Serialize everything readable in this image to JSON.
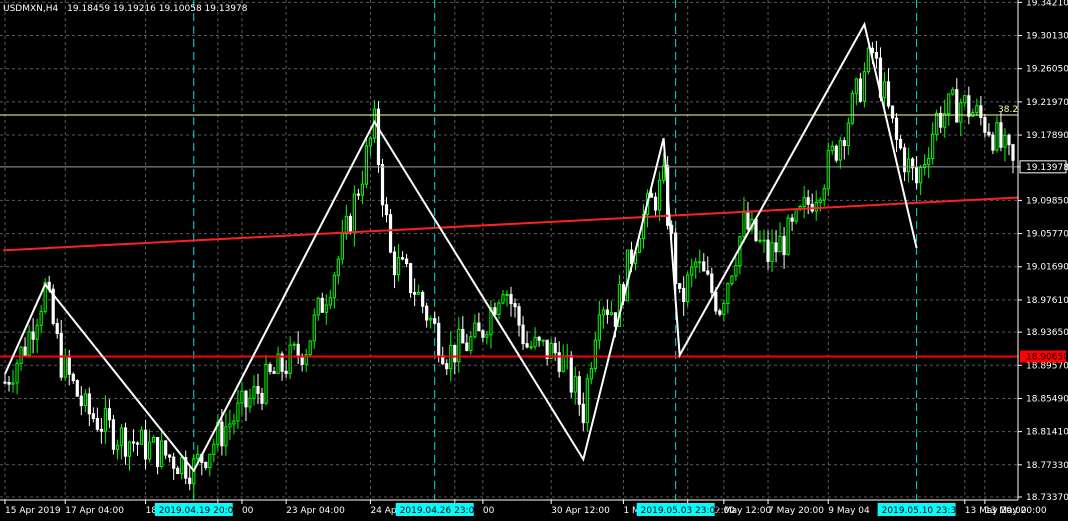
{
  "window": {
    "symbol_timeframe": "USDMXN,H4",
    "ohlc": "19.18459 19.19216 19.10058 19.13978"
  },
  "colors": {
    "background": "#000000",
    "grid": "#5a5a5a",
    "axis": "#ffffff",
    "bull_candle": "#00ff00",
    "bear_candle": "#ffffff",
    "zigzag": "#ffffff",
    "trend_line": "#ff2020",
    "horizontal_line": "#ff0000",
    "fibo_line": "#ffff99",
    "time_marker_line": "#00e0e0",
    "time_marker_box": "#00ffff",
    "price_marker_box": "#ff0000"
  },
  "chart_data": {
    "type": "candlestick",
    "ylim": [
      18.73,
      19.345
    ],
    "y_ticks": [
      "19.34210",
      "19.30130",
      "19.26050",
      "19.21970",
      "19.17890",
      "19.13978",
      "19.09850",
      "19.05770",
      "19.01690",
      "18.97610",
      "18.93650",
      "18.89570",
      "18.85490",
      "18.81410",
      "18.77330",
      "18.73370"
    ],
    "y_tick_values": [
      19.3421,
      19.3013,
      19.2605,
      19.2197,
      19.1789,
      19.13978,
      19.0985,
      19.0577,
      19.0169,
      18.9761,
      18.9365,
      18.8957,
      18.8549,
      18.8141,
      18.7733,
      18.7337
    ],
    "x_ticks": [
      "15 Apr 2019",
      "17 Apr 04:00",
      "18 Ap",
      "00",
      "23 Apr 04:00",
      "24 Apr 12:00",
      "25",
      "30 Apr 12:00",
      "1 May 20:00",
      "May 12:00",
      "7 May 20:00",
      "9 May 04",
      "13 May 20:00"
    ],
    "x_tick_index": [
      0,
      15,
      35,
      53,
      70,
      91,
      112,
      136,
      154,
      170,
      190,
      205,
      244
    ],
    "n_bars": 252,
    "current_price": {
      "value": 19.13978,
      "label": "19.13978"
    },
    "horizontal_line": {
      "value": 18.9065,
      "label": "18.90650"
    },
    "fibo_level": {
      "value": 19.2035,
      "label": "38.2"
    },
    "trend_line": {
      "start": [
        0,
        19.037
      ],
      "end": [
        251,
        19.102
      ]
    },
    "zigzag": [
      [
        0,
        18.885
      ],
      [
        10,
        18.995
      ],
      [
        47,
        18.766
      ],
      [
        92,
        19.195
      ],
      [
        144,
        18.78
      ],
      [
        164,
        19.175
      ],
      [
        168,
        18.908
      ],
      [
        214,
        19.315
      ],
      [
        227,
        19.04
      ]
    ],
    "time_markers": [
      {
        "index": 47,
        "label": "2019.04.19 20:00"
      },
      {
        "index": 107,
        "label": "2019.04.26 23:00"
      },
      {
        "index": 167,
        "label": "2019.05.03 23:00"
      },
      {
        "index": 227,
        "label": "2019.05.10 23:30"
      }
    ],
    "price_path": [
      [
        0,
        18.875
      ],
      [
        5,
        18.92
      ],
      [
        10,
        18.99
      ],
      [
        14,
        18.9
      ],
      [
        20,
        18.84
      ],
      [
        28,
        18.81
      ],
      [
        38,
        18.79
      ],
      [
        47,
        18.77
      ],
      [
        55,
        18.82
      ],
      [
        66,
        18.88
      ],
      [
        75,
        18.92
      ],
      [
        84,
        19.04
      ],
      [
        92,
        19.19
      ],
      [
        96,
        19.03
      ],
      [
        102,
        18.99
      ],
      [
        110,
        18.91
      ],
      [
        118,
        18.93
      ],
      [
        124,
        19.0
      ],
      [
        130,
        18.92
      ],
      [
        138,
        18.91
      ],
      [
        144,
        18.84
      ],
      [
        148,
        18.98
      ],
      [
        152,
        18.96
      ],
      [
        158,
        19.07
      ],
      [
        164,
        19.12
      ],
      [
        168,
        18.97
      ],
      [
        172,
        19.02
      ],
      [
        178,
        18.97
      ],
      [
        184,
        19.07
      ],
      [
        190,
        19.03
      ],
      [
        196,
        19.06
      ],
      [
        204,
        19.13
      ],
      [
        210,
        19.2
      ],
      [
        216,
        19.28
      ],
      [
        222,
        19.17
      ],
      [
        227,
        19.12
      ],
      [
        232,
        19.2
      ],
      [
        238,
        19.22
      ],
      [
        245,
        19.19
      ],
      [
        251,
        19.14
      ]
    ]
  },
  "x_axis_overflow": [
    {
      "index": 59,
      "text": "00"
    },
    {
      "index": 119,
      "text": "00"
    },
    {
      "index": 179,
      "text": "May 12:00"
    },
    {
      "index": 239,
      "text": "13 May 20:00"
    }
  ]
}
